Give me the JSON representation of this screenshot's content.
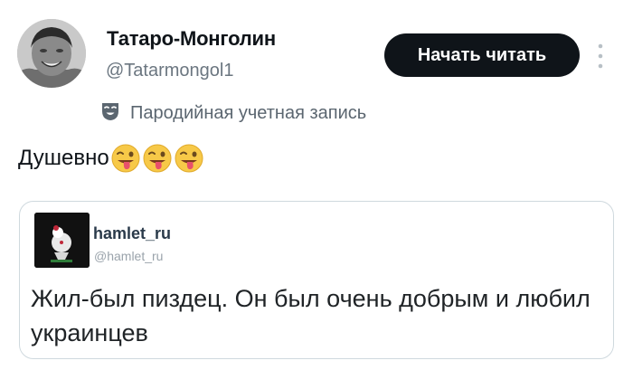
{
  "author": {
    "display_name": "Татаро-Монголин",
    "handle": "@Tatarmongol1",
    "avatar_icon": "user-avatar-photo"
  },
  "header": {
    "follow_label": "Начать читать",
    "more_icon": "more-vertical-icon"
  },
  "parody": {
    "icon": "theater-mask-icon",
    "label": "Пародийная учетная запись"
  },
  "tweet": {
    "text": "Душевно",
    "emojis": [
      "winking-face-with-tongue",
      "winking-face-with-tongue",
      "winking-face-with-tongue"
    ]
  },
  "quote": {
    "name": "hamlet_ru",
    "handle": "@hamlet_ru",
    "text": "Жил-был пиздец. Он был очень добрым и любил украинцев",
    "avatar_icon": "clown-avatar-icon"
  },
  "colors": {
    "button_bg": "#0f1419",
    "secondary_text": "#6b7680",
    "card_border": "#cfd9de"
  }
}
